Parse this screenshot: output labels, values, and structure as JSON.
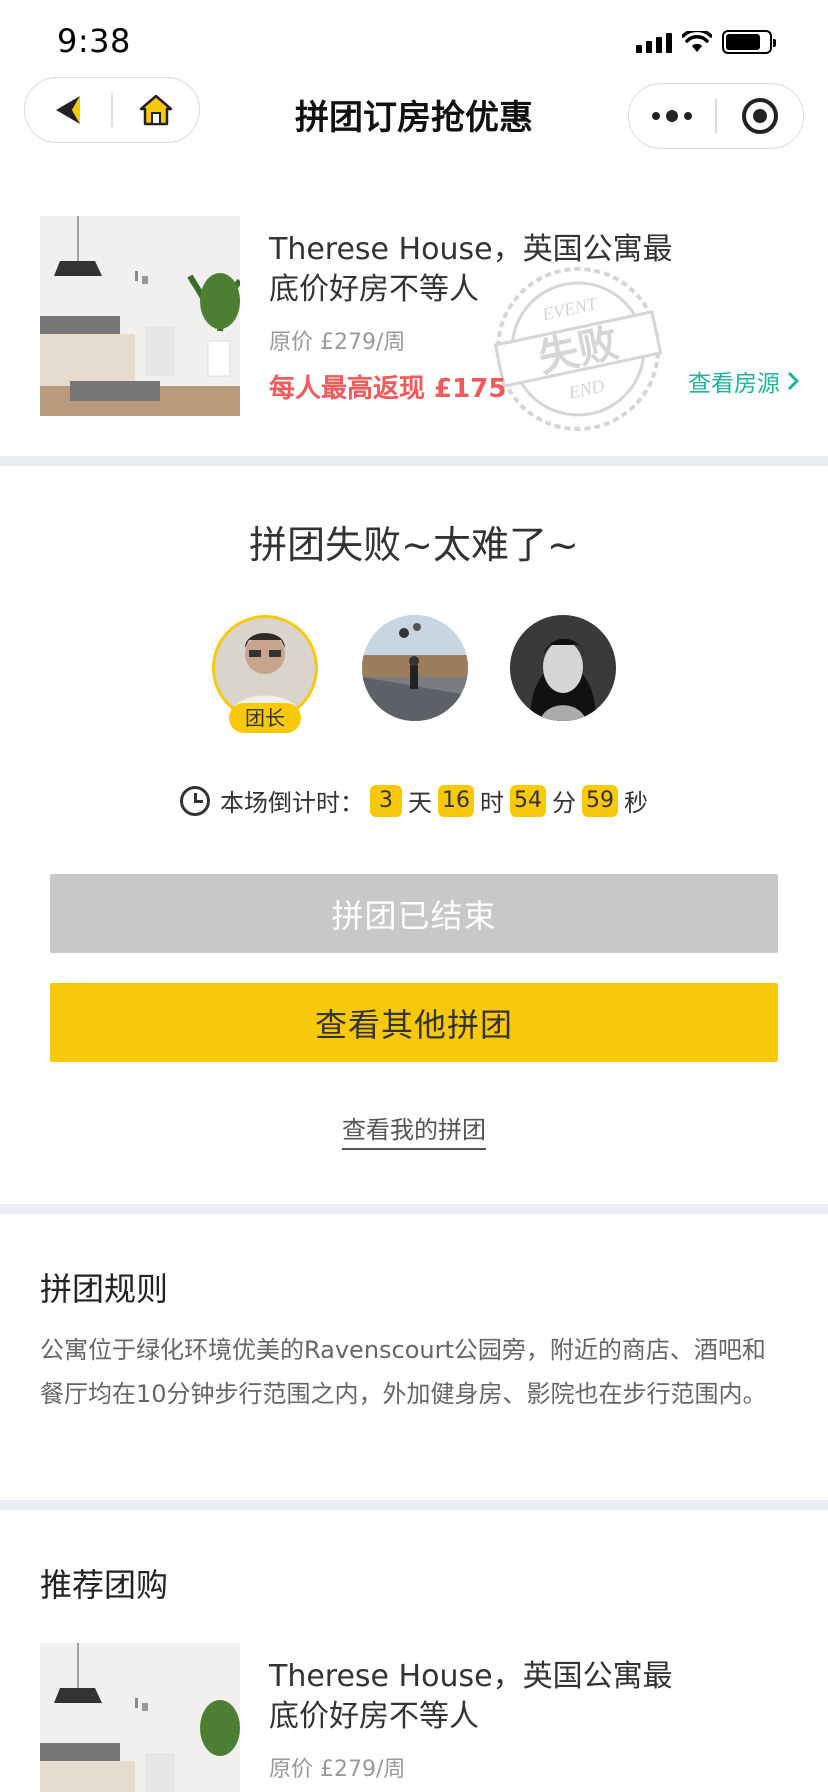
{
  "status_bar": {
    "time": "9:38"
  },
  "nav": {
    "title": "拼团订房抢优惠"
  },
  "product": {
    "title": "Therese House，英国公寓最底价好房不等人",
    "price": "原价 £279/周",
    "cashback": "每人最高返现 £175",
    "link": "查看房源",
    "stamp_top": "EVENT",
    "stamp_main": "失败",
    "stamp_bottom": "END"
  },
  "group": {
    "title": "拼团失败~太难了~",
    "leader_tag": "团长",
    "countdown": {
      "label": "本场倒计时：",
      "days": "3",
      "days_unit": "天",
      "hours": "16",
      "hours_unit": "时",
      "minutes": "54",
      "minutes_unit": "分",
      "seconds": "59",
      "seconds_unit": "秒"
    },
    "ended_button": "拼团已结束",
    "other_button": "查看其他拼团",
    "my_link": "查看我的拼团"
  },
  "rules": {
    "title": "拼团规则",
    "text": "公寓位于绿化环境优美的Ravenscourt公园旁，附近的商店、酒吧和餐厅均在10分钟步行范围之内，外加健身房、影院也在步行范围内。"
  },
  "recommend": {
    "title": "推荐团购",
    "item": {
      "title": "Therese House，英国公寓最底价好房不等人",
      "price": "原价 £279/周"
    }
  },
  "colors": {
    "accent": "#f8c80a",
    "cashback": "#f05a5a",
    "link": "#1fb39a",
    "divider": "#eaedf2",
    "ended": "#c8c8ca"
  }
}
